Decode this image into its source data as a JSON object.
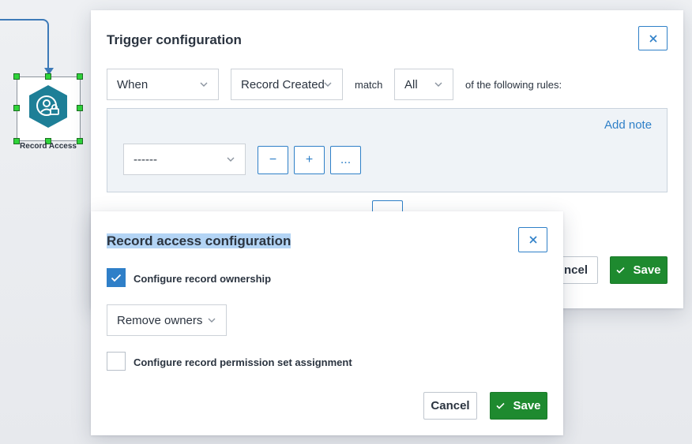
{
  "colors": {
    "accent": "#2f80c8",
    "primary_green": "#1e8a2f",
    "node_teal": "#1e7f97",
    "handle_green": "#2fd43a"
  },
  "flow_node": {
    "label": "Record Access",
    "icon": "user-lock-icon"
  },
  "trigger_dialog": {
    "title": "Trigger configuration",
    "when_value": "When",
    "event_value": "Record Created",
    "match_label": "match",
    "match_value": "All",
    "rules_suffix": "of the following rules:",
    "add_note_label": "Add note",
    "rule_field_value": "------",
    "remove_rule_label": "−",
    "add_rule_label": "+",
    "more_label": "...",
    "cancel_partial_label": "ncel",
    "save_label": "Save"
  },
  "record_access_dialog": {
    "title": "Record access configuration",
    "ownership_label": "Configure record ownership",
    "ownership_checked": true,
    "owners_action_value": "Remove owners",
    "permission_label": "Configure record permission set assignment",
    "permission_checked": false,
    "cancel_label": "Cancel",
    "save_label": "Save"
  }
}
